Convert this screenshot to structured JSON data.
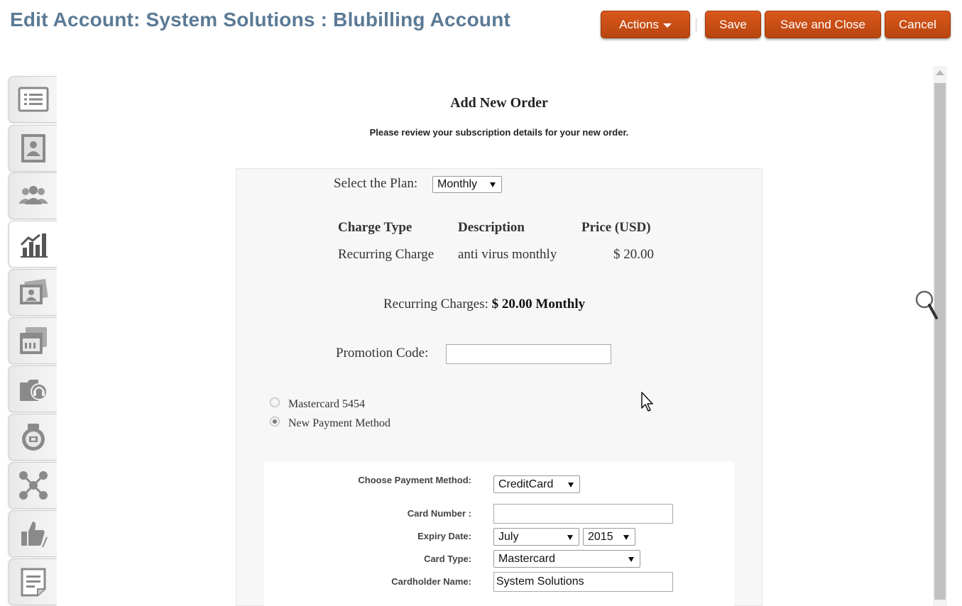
{
  "header": {
    "title": "Edit Account: System Solutions : Blubilling Account",
    "actions_label": "Actions",
    "save_label": "Save",
    "save_close_label": "Save and Close",
    "cancel_label": "Cancel"
  },
  "sidebar": {
    "tabs": [
      {
        "icon": "list-icon",
        "active": false
      },
      {
        "icon": "contact-card-icon",
        "active": false
      },
      {
        "icon": "group-icon",
        "active": false
      },
      {
        "icon": "bar-chart-icon",
        "active": true
      },
      {
        "icon": "contacts-icon",
        "active": false
      },
      {
        "icon": "calendar-icon",
        "active": false
      },
      {
        "icon": "folder-support-icon",
        "active": false
      },
      {
        "icon": "product-icon",
        "active": false
      },
      {
        "icon": "network-icon",
        "active": false
      },
      {
        "icon": "thumbs-up-icon",
        "active": false
      },
      {
        "icon": "note-icon",
        "active": false
      }
    ]
  },
  "order": {
    "title": "Add New Order",
    "subtitle": "Please review your subscription details for your new order.",
    "plan_label": "Select the Plan:",
    "plan_value": "Monthly",
    "table": {
      "headers": [
        "Charge Type",
        "Description",
        "Price (USD)"
      ],
      "rows": [
        [
          "Recurring Charge",
          "anti virus monthly",
          "$ 20.00"
        ]
      ]
    },
    "recurring_label": "Recurring Charges:",
    "recurring_value": "$ 20.00 Monthly",
    "promo_label": "Promotion Code:",
    "promo_value": "",
    "payment_options": [
      {
        "label": "Mastercard 5454",
        "checked": false
      },
      {
        "label": "New Payment Method",
        "checked": true
      }
    ]
  },
  "payment": {
    "method_label": "Choose Payment Method:",
    "method_value": "CreditCard",
    "card_number_label": "Card Number :",
    "card_number_value": "",
    "expiry_label": "Expiry Date:",
    "expiry_month": "July",
    "expiry_year": "2015",
    "card_type_label": "Card Type:",
    "card_type_value": "Mastercard",
    "holder_label": "Cardholder Name:",
    "holder_value": "System Solutions"
  },
  "colors": {
    "button": "#c9501a",
    "title": "#5b7a95",
    "icon": "#8a8a8a"
  }
}
